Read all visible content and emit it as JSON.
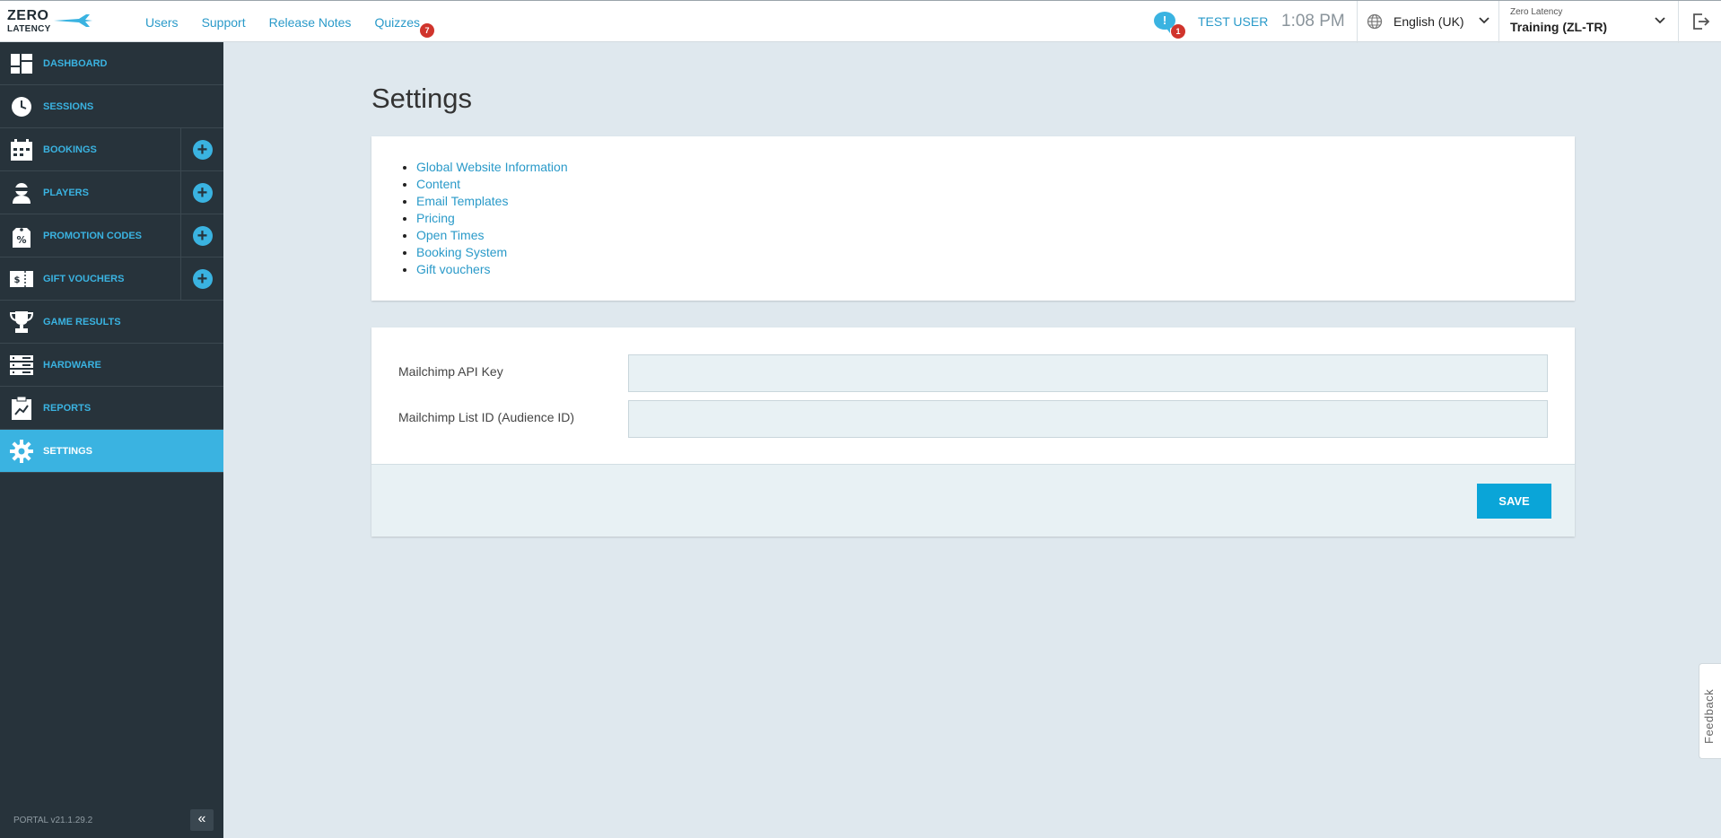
{
  "brand": {
    "line1": "ZERO",
    "line2": "LATENCY"
  },
  "topnav": {
    "users": "Users",
    "support": "Support",
    "release_notes": "Release Notes",
    "quizzes": "Quizzes",
    "quizzes_badge": "7"
  },
  "header": {
    "notification_symbol": "!",
    "notification_count": "1",
    "user": "TEST USER",
    "time": "1:08 PM",
    "language": "English (UK)",
    "site_label": "Zero Latency",
    "site_name": "Training (ZL-TR)"
  },
  "sidebar": {
    "items": [
      {
        "label": "DASHBOARD",
        "icon": "dashboard-icon",
        "has_add": false
      },
      {
        "label": "SESSIONS",
        "icon": "clock-icon",
        "has_add": false
      },
      {
        "label": "BOOKINGS",
        "icon": "calendar-icon",
        "has_add": true
      },
      {
        "label": "PLAYERS",
        "icon": "player-icon",
        "has_add": true
      },
      {
        "label": "PROMOTION CODES",
        "icon": "promo-tag-icon",
        "has_add": true
      },
      {
        "label": "GIFT VOUCHERS",
        "icon": "voucher-icon",
        "has_add": true
      },
      {
        "label": "GAME RESULTS",
        "icon": "trophy-icon",
        "has_add": false
      },
      {
        "label": "HARDWARE",
        "icon": "server-icon",
        "has_add": false
      },
      {
        "label": "REPORTS",
        "icon": "report-icon",
        "has_add": false
      },
      {
        "label": "SETTINGS",
        "icon": "gear-icon",
        "has_add": false,
        "active": true
      }
    ],
    "add_symbol": "+",
    "version": "PORTAL v21.1.29.2",
    "collapse_symbol": "«"
  },
  "main": {
    "title": "Settings",
    "links": [
      "Global Website Information",
      "Content",
      "Email Templates",
      "Pricing",
      "Open Times",
      "Booking System",
      "Gift vouchers"
    ],
    "form": {
      "api_key_label": "Mailchimp API Key",
      "api_key_value": "",
      "list_id_label": "Mailchimp List ID (Audience ID)",
      "list_id_value": "",
      "save_label": "SAVE"
    }
  },
  "feedback": "Feedback",
  "colors": {
    "accent": "#3ab3e1",
    "sidebar_bg": "#27333b",
    "page_bg": "#dfe8ee",
    "badge": "#d0342c",
    "link": "#2a9ac9"
  }
}
